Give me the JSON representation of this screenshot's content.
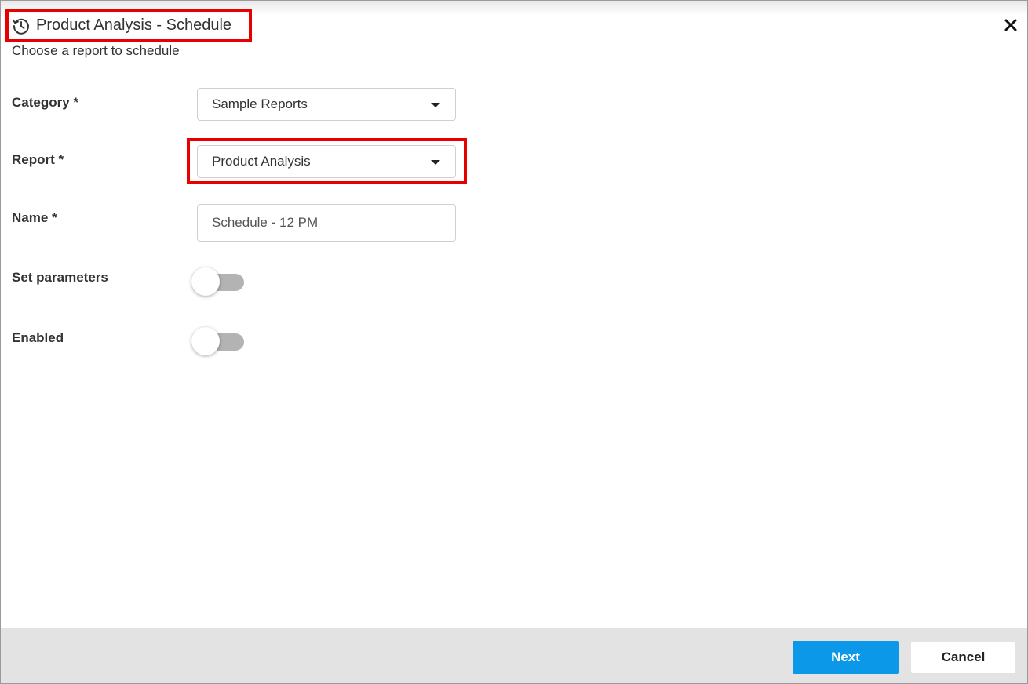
{
  "dialog": {
    "title": "Product Analysis - Schedule",
    "title_icon": "history-icon",
    "subtitle": "Choose a report to schedule",
    "close_icon": "close-icon"
  },
  "form": {
    "category": {
      "label": "Category *",
      "value": "Sample Reports"
    },
    "report": {
      "label": "Report *",
      "value": "Product Analysis"
    },
    "name": {
      "label": "Name *",
      "value": "Schedule - 12 PM"
    },
    "set_parameters": {
      "label": "Set parameters",
      "enabled": false
    },
    "enabled": {
      "label": "Enabled",
      "enabled": false
    }
  },
  "footer": {
    "next_label": "Next",
    "cancel_label": "Cancel"
  },
  "colors": {
    "primary": "#0b98e8",
    "highlight": "#e60000",
    "footer_bg": "#e3e3e3",
    "toggle_off": "#b3b3b3"
  }
}
